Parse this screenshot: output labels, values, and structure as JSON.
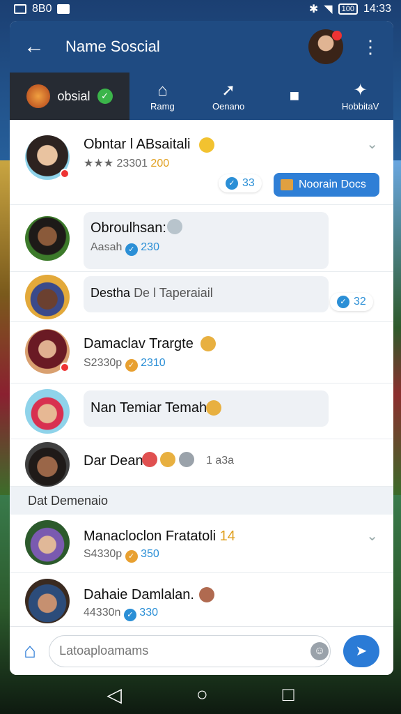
{
  "status_bar": {
    "time": "14:33",
    "left_text": "8B0",
    "battery": "100"
  },
  "app_bar": {
    "title": "Name Soscial",
    "back_icon": "←",
    "menu_icon": "⋮"
  },
  "tabs": [
    {
      "label": "obsial",
      "icon": ""
    },
    {
      "label": "Ramg",
      "icon": "⌂"
    },
    {
      "label": "Oenano",
      "icon": "➚"
    },
    {
      "label": "",
      "icon": "■"
    },
    {
      "label": "HobbitaV",
      "icon": "✦"
    }
  ],
  "chats": [
    {
      "name": "Obntar l ABsaitali",
      "sub_prefix": "★★★ 23301",
      "sub_num": "200",
      "pill": "Noorain Docs",
      "count": "33"
    },
    {
      "name": "Obroulhsan:",
      "sub_prefix": "Aasah",
      "sub_num": "230"
    },
    {
      "name": "Destha",
      "bubble_text": "De l Taperaiail",
      "count": "32"
    },
    {
      "name": "Damaclav Trargte",
      "sub_prefix": "S2330p",
      "sub_num": "2310"
    },
    {
      "name": "Nan Temiar Temah"
    },
    {
      "name": "Dar Dean",
      "extra": "1 a3a"
    }
  ],
  "section_header": "Dat Demenaio",
  "chats2": [
    {
      "name": "Manacloclon Fratatoli",
      "tag": "14",
      "sub_prefix": "S4330p",
      "sub_num": "350"
    },
    {
      "name": "Dahaie Damlalan.",
      "sub_prefix": "44330n",
      "sub_num": "330"
    }
  ],
  "composer": {
    "placeholder": "Latoaploamams"
  },
  "nav": {
    "back": "◁",
    "home": "○",
    "recent": "□"
  },
  "colors": {
    "primary": "#1f4b82",
    "accent": "#2b8fd6",
    "active_tab": "#262b33"
  }
}
